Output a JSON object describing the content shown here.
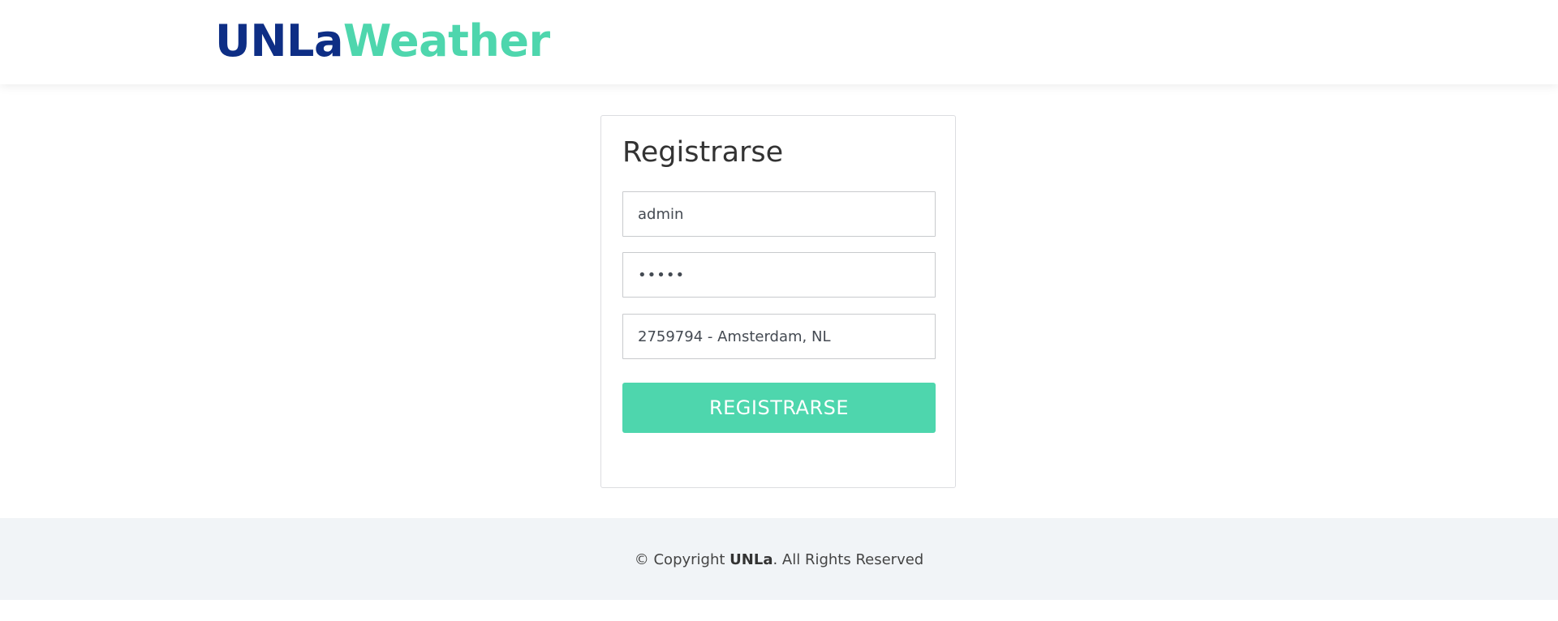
{
  "header": {
    "logo_part1": "UNLa",
    "logo_part2": "Weather"
  },
  "form": {
    "title": "Registrarse",
    "username_value": "admin",
    "password_value": "•••••",
    "city_value": "2759794 - Amsterdam, NL",
    "submit_label": "REGISTRARSE"
  },
  "footer": {
    "copyright_prefix": "© Copyright ",
    "brand": "UNLa",
    "copyright_suffix": ". All Rights Reserved"
  },
  "colors": {
    "logo_dark": "#0e2e85",
    "accent": "#4ed6ad",
    "footer_bg": "#f1f4f7"
  }
}
